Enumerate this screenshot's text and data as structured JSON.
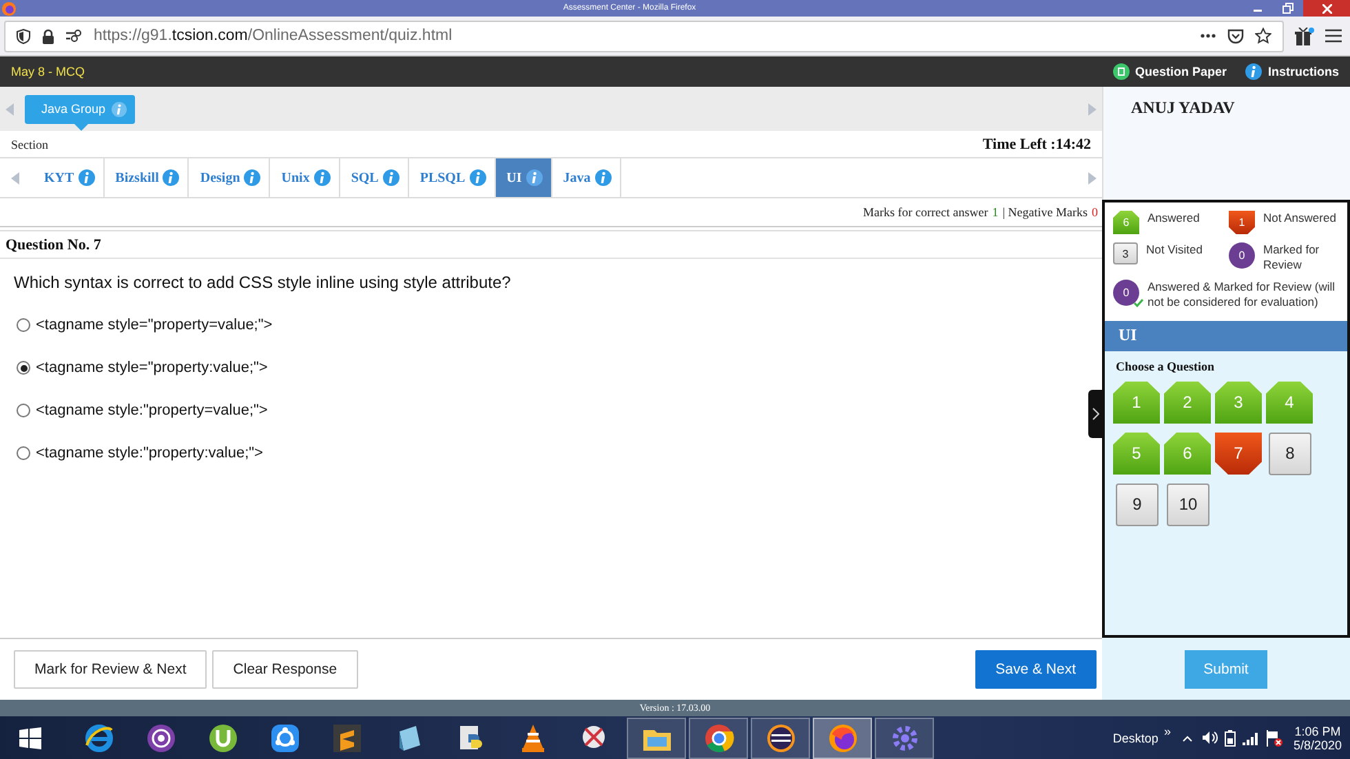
{
  "browser": {
    "title": "Assessment Center - Mozilla Firefox",
    "url": "https://g91.**tcsion.com**/OnlineAssessment/quiz.html"
  },
  "header": {
    "exam": "May 8 - MCQ",
    "links": [
      {
        "label": "Question Paper",
        "kind": "paper"
      },
      {
        "label": "Instructions",
        "kind": "info"
      }
    ]
  },
  "groups": [
    {
      "label": "Java Group",
      "selected": true
    }
  ],
  "section_label": "Section",
  "timer": "Time Left :14:42",
  "sections": [
    {
      "label": "KYT",
      "selected": false
    },
    {
      "label": "Bizskill",
      "selected": false
    },
    {
      "label": "Design",
      "selected": false
    },
    {
      "label": "Unix",
      "selected": false
    },
    {
      "label": "SQL",
      "selected": false
    },
    {
      "label": "PLSQL",
      "selected": false
    },
    {
      "label": "UI",
      "selected": true
    },
    {
      "label": "Java",
      "selected": false
    }
  ],
  "marks": {
    "correct_label": "Marks for correct answer",
    "correct_value": "1",
    "negative_label": "| Negative Marks",
    "negative_value": "0"
  },
  "question": {
    "title": "Question No. 7",
    "text": "Which syntax is correct to add CSS style inline using style attribute?",
    "options": [
      {
        "text": "<tagname style=\"property=value;\">",
        "selected": false
      },
      {
        "text": "<tagname style=\"property:value;\">",
        "selected": true
      },
      {
        "text": "<tagname style:\"property=value;\">",
        "selected": false
      },
      {
        "text": "<tagname style:\"property:value;\">",
        "selected": false
      }
    ]
  },
  "actions": [
    {
      "label": "Mark for Review & Next",
      "kind": "secondary"
    },
    {
      "label": "Clear Response",
      "kind": "secondary"
    },
    {
      "label": "Save & Next",
      "kind": "primary"
    }
  ],
  "candidate": "ANUJ YADAV",
  "legend": [
    {
      "count": "6",
      "label": "Answered",
      "kind": "answered"
    },
    {
      "count": "1",
      "label": "Not Answered",
      "kind": "not_answered"
    },
    {
      "count": "3",
      "label": "Not Visited",
      "kind": "not_visited"
    },
    {
      "count": "0",
      "label": "Marked for Review",
      "kind": "marked"
    },
    {
      "count": "0",
      "label": "Answered & Marked for Review (will not be considered for evaluation)",
      "kind": "answered_marked"
    }
  ],
  "palette": {
    "section": "UI",
    "heading": "Choose a Question",
    "questions": [
      {
        "number": "1",
        "kind": "answered"
      },
      {
        "number": "2",
        "kind": "answered"
      },
      {
        "number": "3",
        "kind": "answered"
      },
      {
        "number": "4",
        "kind": "answered"
      },
      {
        "number": "5",
        "kind": "answered"
      },
      {
        "number": "6",
        "kind": "answered"
      },
      {
        "number": "7",
        "kind": "not_answered"
      },
      {
        "number": "8",
        "kind": "not_visited"
      },
      {
        "number": "9",
        "kind": "not_visited"
      },
      {
        "number": "10",
        "kind": "not_visited"
      }
    ]
  },
  "submit": "Submit",
  "version": "Version : 17.03.00",
  "taskbar": {
    "apps": [
      {
        "running": false,
        "selected": false
      },
      {
        "running": false,
        "selected": false
      },
      {
        "running": false,
        "selected": false
      },
      {
        "running": false,
        "selected": false
      },
      {
        "running": false,
        "selected": false
      },
      {
        "running": false,
        "selected": false
      },
      {
        "running": false,
        "selected": false
      },
      {
        "running": false,
        "selected": false
      },
      {
        "running": false,
        "selected": false
      },
      {
        "running": true,
        "selected": false
      },
      {
        "running": true,
        "selected": false
      },
      {
        "running": true,
        "selected": false
      },
      {
        "running": true,
        "selected": true
      },
      {
        "running": true,
        "selected": false
      }
    ],
    "desktop": "Desktop",
    "chevron": "»",
    "time": "1:06 PM",
    "date": "5/8/2020"
  }
}
